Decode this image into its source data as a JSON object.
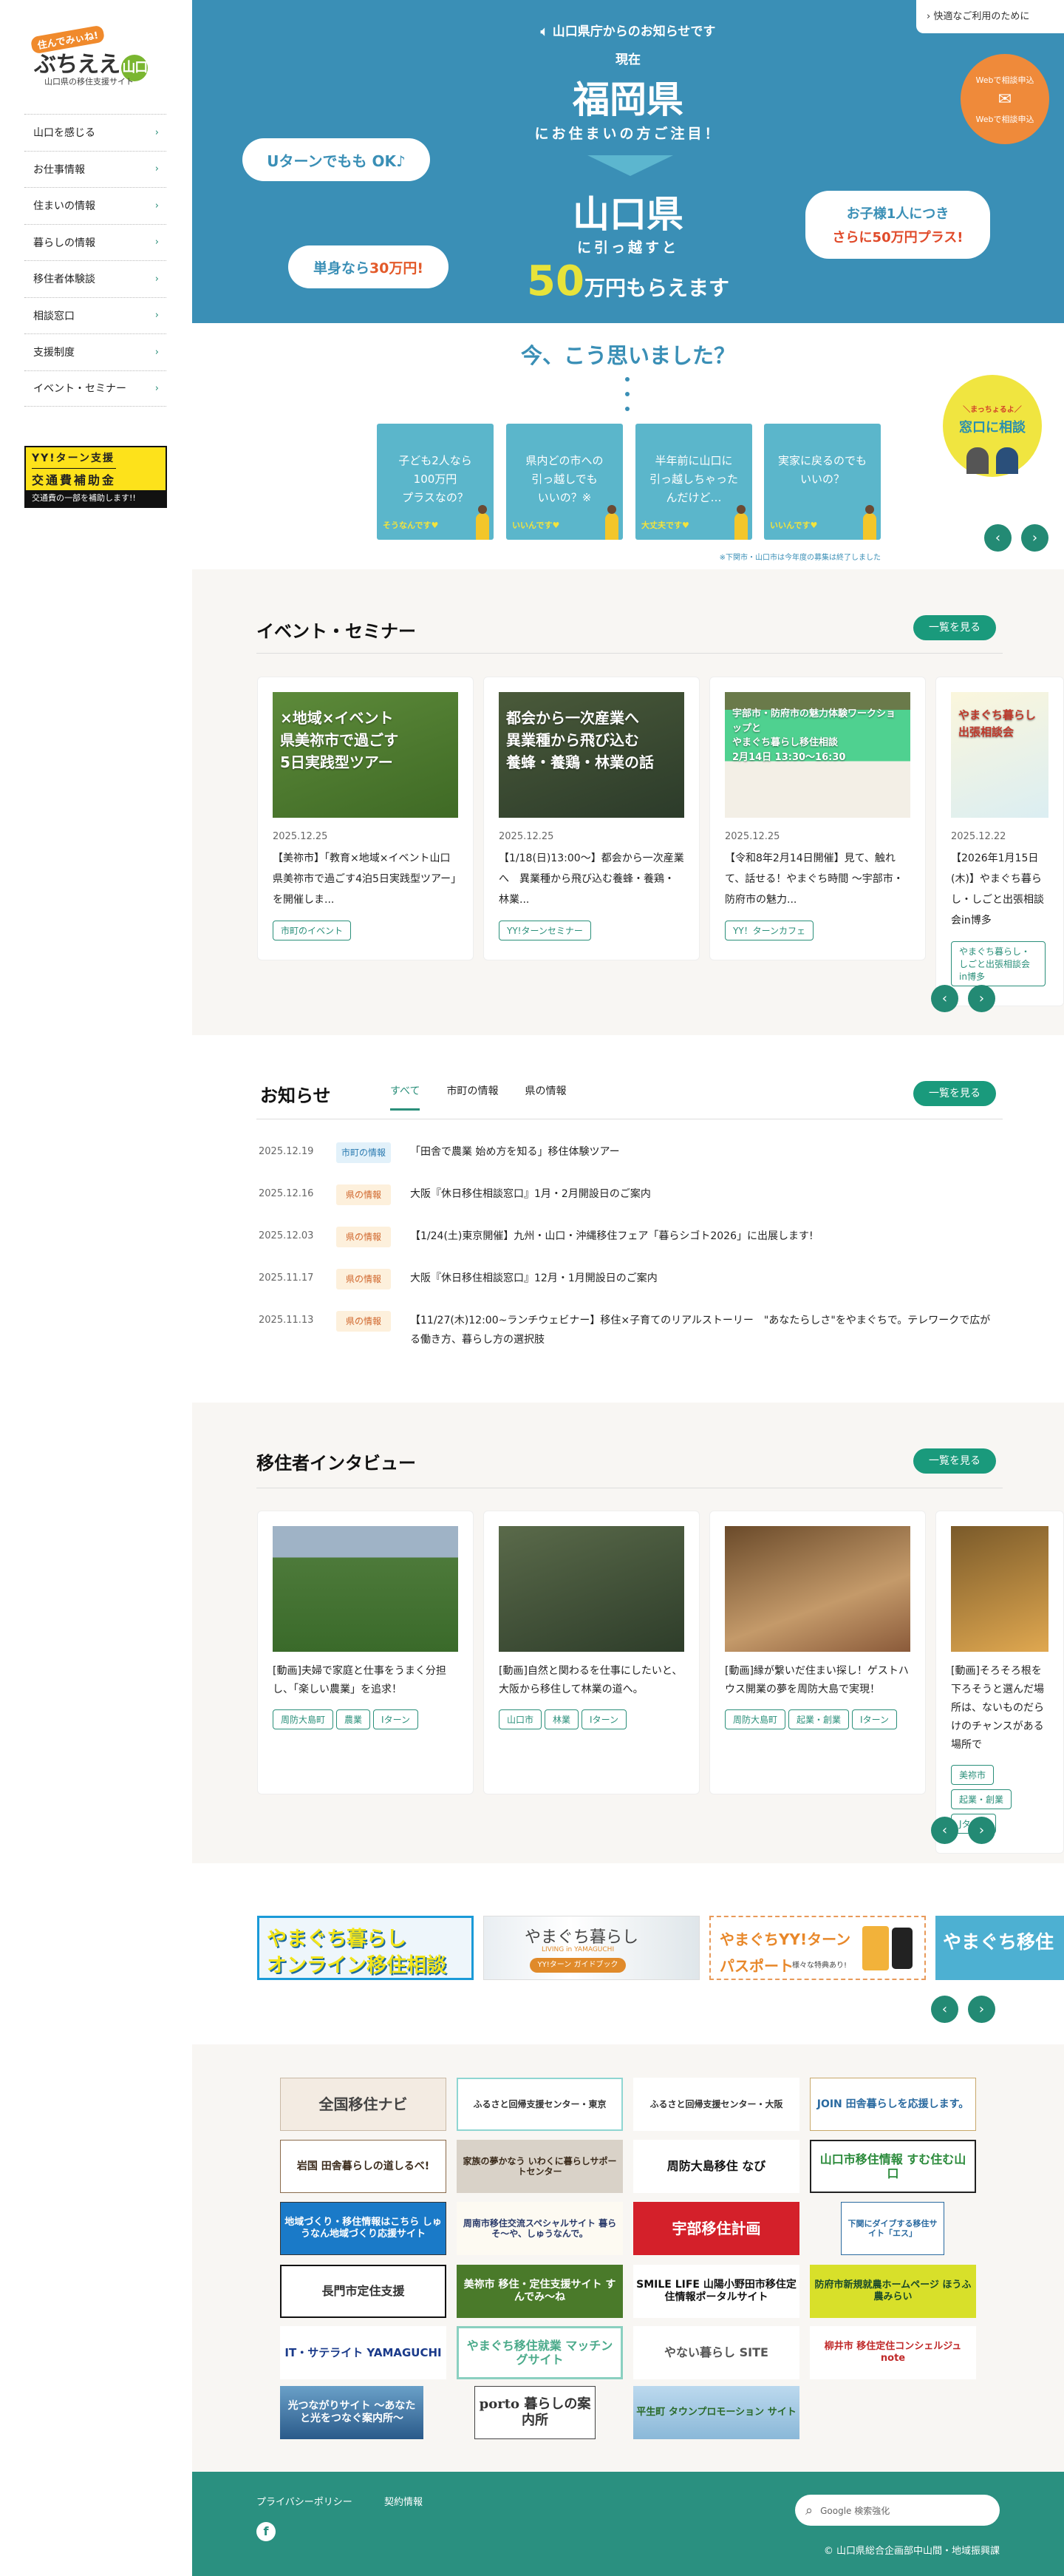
{
  "sidebar": {
    "logo": {
      "tag": "住んでみぃね!",
      "main": "ぶちええ",
      "badge": "山口",
      "subtitle": "山口県の移住支援サイト"
    },
    "nav": [
      {
        "label": "山口を感じる"
      },
      {
        "label": "お仕事情報"
      },
      {
        "label": "住まいの情報"
      },
      {
        "label": "暮らしの情報"
      },
      {
        "label": "移住者体験談"
      },
      {
        "label": "相談窓口"
      },
      {
        "label": "支援制度"
      },
      {
        "label": "イベント・セミナー"
      }
    ],
    "chevron": "›",
    "yy_banner": {
      "line1": "YY!ターン支援",
      "line2": "交通費補助金",
      "line3": "交通費の一部を補助します!!"
    }
  },
  "hero": {
    "access_link": "快適なご利用のために",
    "notice": "山口県庁からのお知らせです",
    "now": "現在",
    "from_pref": "福岡県",
    "attention": "にお住まいの方ご注目！",
    "to_pref": "山口県",
    "move": "に引っ越すと",
    "amount_num": "50",
    "amount_text": "万円もらえます",
    "bubble_uturn": "Uターンでもも OK♪",
    "bubble_single_a": "単身なら",
    "bubble_single_b": "30万円!",
    "bubble_child_a": "お子様1人につき",
    "bubble_child_b": "さらに50万円プラス!",
    "web_consult_top": "Webで相談申込",
    "web_consult_bottom": "Webで相談申込"
  },
  "think": {
    "title": "今、こう思いました？",
    "cards": [
      {
        "q": "子ども2人なら\n100万円\nプラスなの？",
        "a": "そうなんです♥"
      },
      {
        "q": "県内どの市への\n引っ越しでも\nいいの？※",
        "a": "いいんです♥"
      },
      {
        "q": "半年前に山口に\n引っ越しちゃった\nんだけど…",
        "a": "大丈夫です♥"
      },
      {
        "q": "実家に戻るのでも\nいいの？",
        "a": "いいんです♥"
      }
    ],
    "consult_small": "＼まっちょるよ／",
    "consult_main": "窓口に相談",
    "footnote": "※下関市・山口市は今年度の募集は終了しました"
  },
  "arrows": {
    "prev": "‹",
    "next": "›"
  },
  "events": {
    "title": "イベント・セミナー",
    "more": "一覧を見る",
    "cards": [
      {
        "img_text": "×地域×イベント\n県美祢市で過ごす\n5日実践型ツアー",
        "date": "2025.12.25",
        "title": "【美祢市】「教育×地域×イベント山口県美祢市で過ごす4泊5日実践型ツアー」を開催しま...",
        "tag": "市町のイベント"
      },
      {
        "img_text": "都会から一次産業へ\n異業種から飛び込む\n養蜂・養鶏・林業の話",
        "date": "2025.12.25",
        "title": "【1/18(日)13:00〜】都会から一次産業へ　異業種から飛び込む養蜂・養鶏・林業...",
        "tag": "YY!ターンセミナー"
      },
      {
        "img_text": "宇部市・防府市の魅力体験ワークショップと\nやまぐち暮らし移住相談\n2月14日 13:30〜16:30",
        "date": "2025.12.25",
        "title": "【令和8年2月14日開催】見て、触れて、話せる！やまぐち時間 〜宇部市・防府市の魅力...",
        "tag": "YY！ターンカフェ"
      },
      {
        "img_text": "やまぐち暮らし\n出張相談会",
        "date": "2025.12.22",
        "title": "【2026年1月15日(木)】やまぐち暮らし・しごと出張相談会in博多",
        "tag": "やまぐち暮らし・しごと出張相談会in博多"
      }
    ]
  },
  "news": {
    "title": "お知らせ",
    "tabs": [
      "すべて",
      "市町の情報",
      "県の情報"
    ],
    "more": "一覧を見る",
    "items": [
      {
        "date": "2025.12.19",
        "badge": "市町の情報",
        "type": "city",
        "text": "「田舎で農業 始め方を知る」移住体験ツアー"
      },
      {
        "date": "2025.12.16",
        "badge": "県の情報",
        "type": "pref",
        "text": "大阪『休日移住相談窓口』1月・2月開設日のご案内"
      },
      {
        "date": "2025.12.03",
        "badge": "県の情報",
        "type": "pref",
        "text": "【1/24(土)東京開催】九州・山口・沖縄移住フェア「暮らシゴト2026」に出展します!"
      },
      {
        "date": "2025.11.17",
        "badge": "県の情報",
        "type": "pref",
        "text": "大阪『休日移住相談窓口』12月・1月開設日のご案内"
      },
      {
        "date": "2025.11.13",
        "badge": "県の情報",
        "type": "pref",
        "text": "【11/27(木)12:00~ランチウェビナー】移住×子育てのリアルストーリー　\"あなたらしさ\"をやまぐちで。テレワークで広がる働き方、暮らし方の選択肢"
      }
    ]
  },
  "interviews": {
    "title": "移住者インタビュー",
    "more": "一覧を見る",
    "cards": [
      {
        "title": "[動画]夫婦で家庭と仕事をうまく分担し、「楽しい農業」を追求！",
        "tags": [
          "周防大島町",
          "農業",
          "Iターン"
        ]
      },
      {
        "title": "[動画]自然と関わるを仕事にしたいと、大阪から移住して林業の道へ。",
        "tags": [
          "山口市",
          "林業",
          "Iターン"
        ]
      },
      {
        "title": "[動画]縁が繋いだ住まい探し！ゲストハウス開業の夢を周防大島で実現！",
        "tags": [
          "周防大島町",
          "起業・創業",
          "Iターン"
        ]
      },
      {
        "title": "[動画]そろそろ根を下ろそうと選んだ場所は、ないものだらけのチャンスがある場所で",
        "tags": [
          "美祢市",
          "起業・創業",
          "Jターン"
        ]
      }
    ]
  },
  "banners": [
    {
      "l1": "やまぐち暮らし",
      "l2": "オンライン移住相談"
    },
    {
      "l1": "やまぐち暮らし",
      "l2": "LIVING in YAMAGUCHI",
      "l3": "YY!ターン ガイドブック"
    },
    {
      "l1": "やまぐちYY!ターン",
      "l2": "パスポート",
      "l3": "様々な特典あり!"
    },
    {
      "l1": "やまぐち移住"
    }
  ],
  "links": [
    "全国移住ナビ",
    "ふるさと回帰支援センター・東京",
    "ふるさと回帰支援センター・大阪",
    "JOIN 田舎暮らしを応援します。",
    "岩国 田舎暮らしの道しるべ!",
    "家族の夢かなう いわくに暮らしサポートセンター",
    "周防大島移住 なび",
    "山口市移住情報 すむ住む山口",
    "地域づくり・移住情報はこちら しゅうなん地域づくり応援サイト",
    "周南市移住交流スペシャルサイト 暮らそ〜や、しゅうなんで。",
    "宇部移住計画",
    "下関にダイブする移住サイト「エス」",
    "長門市定住支援",
    "美祢市 移住・定住支援サイト すんでみ〜ね",
    "SMILE LIFE 山陽小野田市移住定住情報ポータルサイト",
    "防府市新規就農ホームページ ほうふ農みらい",
    "IT・サテライト YAMAGUCHI",
    "やまぐち移住就業 マッチングサイト",
    "やない暮らし SITE",
    "柳井市 移住定住コンシェルジュ note",
    "光つながりサイト 〜あなたと光をつなぐ案内所〜",
    "porto 暮らしの案内所",
    "平生町 タウンプロモーション サイト"
  ],
  "footer": {
    "links": [
      "プライバシーポリシー",
      "契約情報"
    ],
    "search_placeholder": "Google 検索強化",
    "copyright": "© 山口県総合企画部中山間・地域振興課"
  }
}
